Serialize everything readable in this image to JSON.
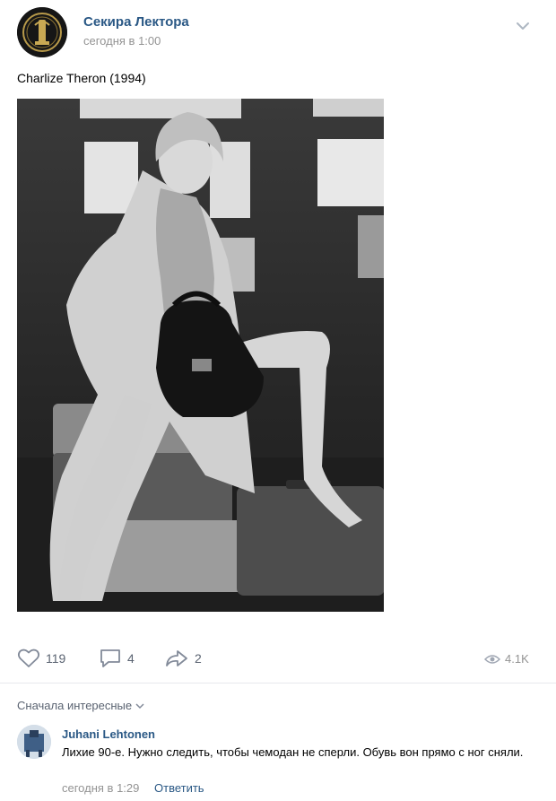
{
  "post": {
    "author": "Секира Лектора",
    "time": "сегодня в 1:00",
    "text": "Charlize Theron (1994)"
  },
  "actions": {
    "likes": "119",
    "comments": "4",
    "shares": "2",
    "views": "4.1K"
  },
  "comments_section": {
    "sort_label": "Сначала интересные",
    "comment": {
      "author": "Juhani Lehtonen",
      "text": "Лихие 90-е. Нужно следить, чтобы чемодан не сперли. Обувь вон прямо с ног сняли.",
      "time": "сегодня в 1:29",
      "reply_label": "Ответить"
    }
  },
  "colors": {
    "link": "#2a5885",
    "muted": "#939393",
    "icon": "#5a6371"
  }
}
